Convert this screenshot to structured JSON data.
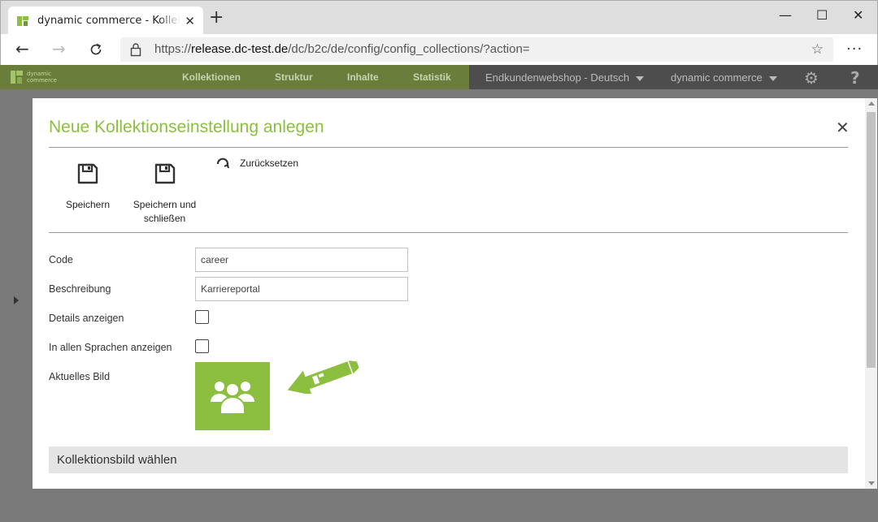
{
  "browser": {
    "tab_title": "dynamic commerce - Kollektionen",
    "url_prefix": "https://",
    "url_domain": "release.dc-test.de",
    "url_path": "/dc/b2c/de/config/config_collections/?action=",
    "new_tab_symbol": "+",
    "window_controls": [
      "—",
      "☐",
      "✕"
    ]
  },
  "app_header": {
    "brand_line1": "dynamic",
    "brand_line2": "commerce",
    "menu": [
      "Kollektionen",
      "Struktur",
      "Inhalte",
      "Statistik"
    ],
    "shop_dropdown": "Endkundenwebshop - Deutsch",
    "company_dropdown": "dynamic commerce",
    "help_symbol": "?"
  },
  "modal": {
    "title": "Neue Kollektionseinstellung anlegen",
    "toolbar": {
      "save_label": "Speichern",
      "save_close_label_1": "Speichern und",
      "save_close_label_2": "schließen",
      "reset_label": "Zurücksetzen"
    },
    "form": {
      "code_label": "Code",
      "code_value": "career",
      "description_label": "Beschreibung",
      "description_value": "Karriereportal",
      "show_details_label": "Details anzeigen",
      "show_details_checked": false,
      "all_languages_label": "In allen Sprachen anzeigen",
      "all_languages_checked": false,
      "current_image_label": "Aktuelles Bild"
    },
    "section_title": "Kollektionsbild wählen"
  },
  "colors": {
    "accent_green": "#8cbf3f",
    "header_green": "#6b7d3a",
    "header_gray": "#4d4d4d",
    "overlay_gray": "#7a7a7a"
  },
  "icons": [
    "favicon-icon",
    "close-icon",
    "back-arrow-icon",
    "forward-arrow-icon",
    "reload-icon",
    "lock-icon",
    "star-icon",
    "more-icon",
    "gear-icon",
    "help-icon",
    "floppy-disk-icon",
    "reset-icon",
    "users-icon",
    "arrow-pointer-icon"
  ]
}
